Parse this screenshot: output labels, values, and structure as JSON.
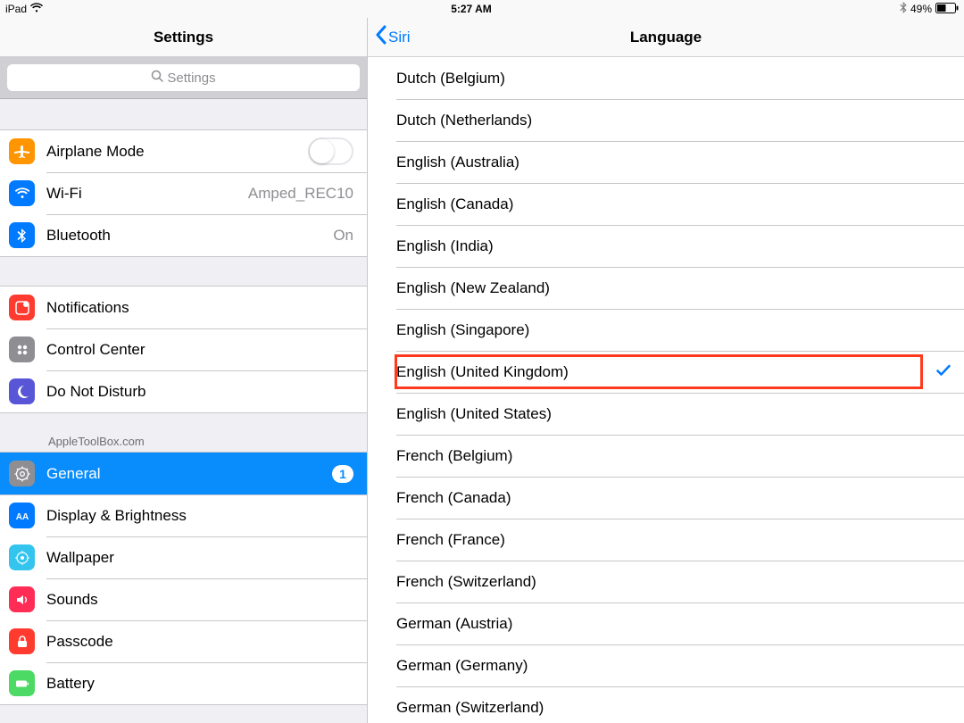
{
  "status": {
    "device": "iPad",
    "time": "5:27 AM",
    "battery_pct": "49%"
  },
  "sidebar": {
    "title": "Settings",
    "search_placeholder": "Settings",
    "attribution": "AppleToolBox.com",
    "group0": [
      {
        "label": "Airplane Mode",
        "value": ""
      },
      {
        "label": "Wi-Fi",
        "value": "Amped_REC10"
      },
      {
        "label": "Bluetooth",
        "value": "On"
      }
    ],
    "group1": [
      {
        "label": "Notifications"
      },
      {
        "label": "Control Center"
      },
      {
        "label": "Do Not Disturb"
      }
    ],
    "group2": [
      {
        "label": "General",
        "badge": "1"
      },
      {
        "label": "Display & Brightness"
      },
      {
        "label": "Wallpaper"
      },
      {
        "label": "Sounds"
      },
      {
        "label": "Passcode"
      },
      {
        "label": "Battery"
      }
    ]
  },
  "detail": {
    "back_label": "Siri",
    "title": "Language",
    "languages": [
      "Dutch (Belgium)",
      "Dutch (Netherlands)",
      "English (Australia)",
      "English (Canada)",
      "English (India)",
      "English (New Zealand)",
      "English (Singapore)",
      "English (United Kingdom)",
      "English (United States)",
      "French (Belgium)",
      "French (Canada)",
      "French (France)",
      "French (Switzerland)",
      "German (Austria)",
      "German (Germany)",
      "German (Switzerland)"
    ],
    "selected_index": 7,
    "highlighted_index": 7
  }
}
